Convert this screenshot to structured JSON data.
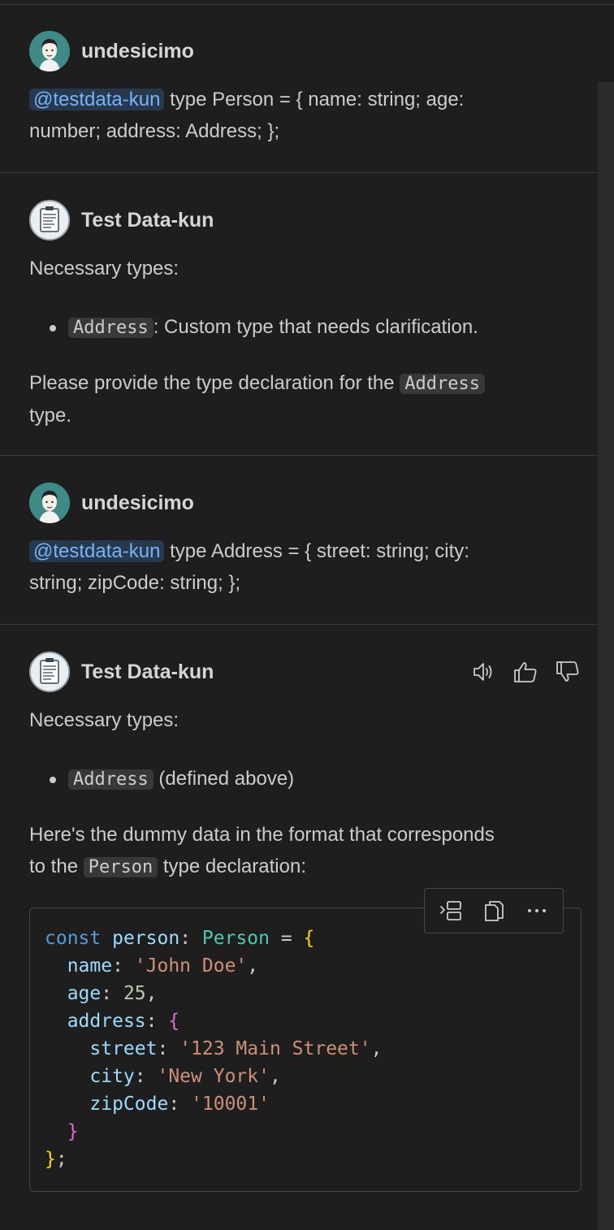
{
  "messages": [
    {
      "author": "undesicimo",
      "mention": "@testdata-kun",
      "text_line1": " type Person = { name: string; age:",
      "text_line2": "number; address: Address; };"
    },
    {
      "author": "Test Data-kun",
      "intro": "Necessary types:",
      "bullet_code": "Address",
      "bullet_text": ": Custom type that needs clarification.",
      "request_pre": "Please provide the type declaration for the ",
      "request_code": "Address",
      "request_post_line": "type."
    },
    {
      "author": "undesicimo",
      "mention": "@testdata-kun",
      "text_line1": " type Address = { street: string; city:",
      "text_line2": "string; zipCode: string; };"
    },
    {
      "author": "Test Data-kun",
      "intro": "Necessary types:",
      "bullet_code": "Address",
      "bullet_text": " (defined above)",
      "para_line1": "Here's the dummy data in the format that corresponds",
      "para_pre": "to the ",
      "para_code": "Person",
      "para_post": " type declaration:"
    }
  ],
  "actions": {
    "read_aloud_icon": "speaker-icon",
    "thumbs_up_icon": "thumbs-up-icon",
    "thumbs_down_icon": "thumbs-down-icon"
  },
  "code_toolbar": {
    "insert_icon": "insert-at-cursor-icon",
    "copy_icon": "copy-icon",
    "more_icon": "more-icon"
  },
  "code": {
    "line1": {
      "kw": "const",
      "var": "person",
      "colon": ": ",
      "type": "Person",
      "eq": " = ",
      "brace": "{"
    },
    "line2": {
      "key": "name",
      "sep": ": ",
      "val": "'John Doe'",
      "end": ","
    },
    "line3": {
      "key": "age",
      "sep": ": ",
      "val": "25",
      "end": ","
    },
    "line4": {
      "key": "address",
      "sep": ": ",
      "brace": "{"
    },
    "line5": {
      "key": "street",
      "sep": ": ",
      "val": "'123 Main Street'",
      "end": ","
    },
    "line6": {
      "key": "city",
      "sep": ": ",
      "val": "'New York'",
      "end": ","
    },
    "line7": {
      "key": "zipCode",
      "sep": ": ",
      "val": "'10001'"
    },
    "line8": {
      "brace": "}"
    },
    "line9": {
      "brace": "}",
      "end": ";"
    }
  },
  "colors": {
    "background": "#1e1e1e",
    "mention_bg": "#26394f",
    "mention_fg": "#78b3f5",
    "inline_code_bg": "#383838"
  }
}
